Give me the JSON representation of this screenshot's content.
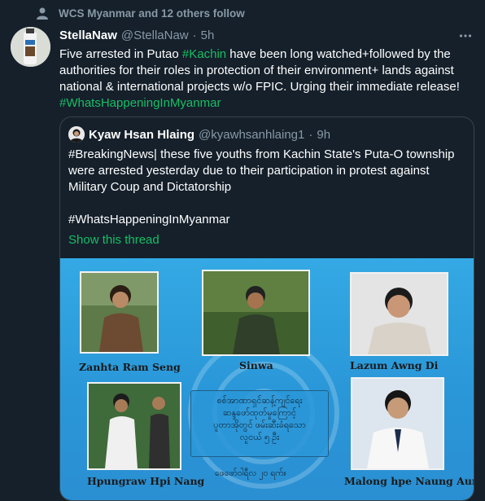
{
  "social_context": {
    "text": "WCS Myanmar and 12 others follow",
    "icon": "person-icon"
  },
  "tweet": {
    "author_name": "StellaNaw",
    "author_handle": "@StellaNaw",
    "separator": "·",
    "time": "5h",
    "text_before_tag": "Five arrested in Putao ",
    "tag1": "#Kachin",
    "text_after_tag": " have been long watched+followed by the authorities for their roles in protection of their environment+ lands against national & international projects w/o FPIC. Urging their immediate release!",
    "tag2": "#WhatsHappeningInMyanmar"
  },
  "quote": {
    "author_name": "Kyaw Hsan Hlaing",
    "author_handle": "@kyawhsanhlaing1",
    "separator": "·",
    "time": "9h",
    "text": "#BreakingNews| these five youths from Kachin State's Puta-O township were arrested yesterday due to their participation in protest against Military Coup and Dictatorship\n\n#WhatsHappeningInMyanmar",
    "show_thread": "Show this thread"
  },
  "image": {
    "captions": [
      "Zanhta Ram Seng",
      "Sinwa",
      "Lazum Awng Di",
      "Hpungraw Hpi Nang",
      "Malong hpe Naung Aung"
    ],
    "burmese_lines": [
      "စစ်အာဏာရှင်ဆန့်ကျင်ရေး",
      "ဆန္ဒဖော်ထုတ်မှုကြောင့်",
      "ပူတာအိုတွင် ဖမ်းဆီးခံရသော",
      "လူငယ် ၅ ဦး"
    ],
    "date_text": "ဖေဖော်ဝါရီလ ၂၀ ရက်။"
  },
  "colors": {
    "background": "#15202b",
    "accent": "#17bf63",
    "muted": "#8899a6",
    "border": "#38444d",
    "image_blue": "#2a97d8"
  }
}
